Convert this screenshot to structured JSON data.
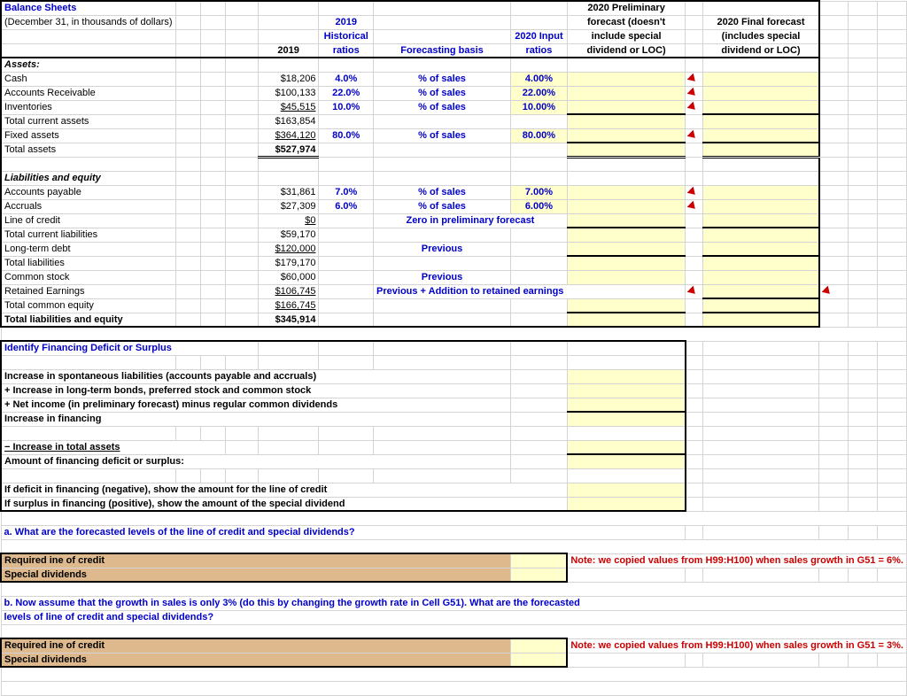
{
  "title": "Balance Sheets",
  "subtitle": "(December 31, in thousands of dollars)",
  "headers": {
    "y2019": "2019",
    "hist_ratios_1": "2019",
    "hist_ratios_2": "Historical",
    "hist_ratios_3": "ratios",
    "forecast_basis": "Forecasting basis",
    "input_ratios_1": "2020 Input",
    "input_ratios_2": "ratios",
    "prelim_1": "2020 Preliminary",
    "prelim_2": "forecast (doesn't",
    "prelim_3": "include special",
    "prelim_4": "dividend or LOC)",
    "final_1": "2020 Final forecast",
    "final_2": "(includes special",
    "final_3": "dividend or LOC)"
  },
  "sections": {
    "assets": "Assets:",
    "liab": "Liabilities and equity"
  },
  "rows": {
    "cash": {
      "label": "Cash",
      "v2019": "$18,206",
      "hist": "4.0%",
      "basis": "% of sales",
      "input": "4.00%"
    },
    "ar": {
      "label": "Accounts Receivable",
      "v2019": "$100,133",
      "hist": "22.0%",
      "basis": "% of sales",
      "input": "22.00%"
    },
    "inv": {
      "label": "Inventories",
      "v2019": "$45,515",
      "hist": "10.0%",
      "basis": "% of sales",
      "input": "10.00%"
    },
    "tca": {
      "label": "  Total current assets",
      "v2019": "$163,854"
    },
    "fa": {
      "label": "  Fixed assets",
      "v2019": "$364,120",
      "hist": "80.0%",
      "basis": "% of sales",
      "input": "80.00%"
    },
    "ta": {
      "label": "Total assets",
      "v2019": "$527,974"
    },
    "ap": {
      "label": "Accounts payable",
      "v2019": "$31,861",
      "hist": "7.0%",
      "basis": "% of sales",
      "input": "7.00%"
    },
    "acc": {
      "label": "Accruals",
      "v2019": "$27,309",
      "hist": "6.0%",
      "basis": "% of sales",
      "input": "6.00%"
    },
    "loc": {
      "label": "Line of credit",
      "v2019": "$0",
      "basis": "Zero in preliminary forecast"
    },
    "tcl": {
      "label": "  Total current liabilities",
      "v2019": "$59,170"
    },
    "ltd": {
      "label": "Long-term debt",
      "v2019": "$120,000",
      "basis": "Previous"
    },
    "tl": {
      "label": "  Total liabilities",
      "v2019": "$179,170"
    },
    "cs": {
      "label": "Common stock",
      "v2019": "$60,000",
      "basis": "Previous"
    },
    "re": {
      "label": "Retained Earnings",
      "v2019": "$106,745",
      "basis": "Previous + Addition to retained earnings"
    },
    "tce": {
      "label": "  Total common equity",
      "v2019": "$166,745"
    },
    "tle": {
      "label": "Total liabilities and equity",
      "v2019": "$345,914"
    }
  },
  "deficit": {
    "title": "Identify Financing Deficit or Surplus",
    "l1": "Increase in spontaneous liabilities (accounts payable and accruals)",
    "l2": "+ Increase in long-term bonds, preferred stock and common stock",
    "l3": "+ Net income (in preliminary forecast) minus regular common dividends",
    "l4": "   Increase in financing",
    "l5": "− Increase in total assets",
    "l6": "   Amount of financing deficit or surplus:",
    "l7": "If deficit in financing (negative), show the amount for the line of credit",
    "l8": "If surplus in financing (positive), show the amount of the special dividend"
  },
  "qa": {
    "a_q": "a. What are the forecasted levels of the line of credit and special dividends?",
    "req_loc": "Required ine of credit",
    "spec_div": "Special dividends",
    "note6": "Note: we copied values from H99:H100) when sales growth in G51 = 6%.",
    "b_q1": "b. Now assume that the growth in sales is only 3% (do this by changing the growth rate in Cell G51). What are the forecasted",
    "b_q2": "levels of line of credit and special dividends?",
    "note3": "Note: we copied values from H99:H100) when sales growth in G51 = 3%."
  }
}
